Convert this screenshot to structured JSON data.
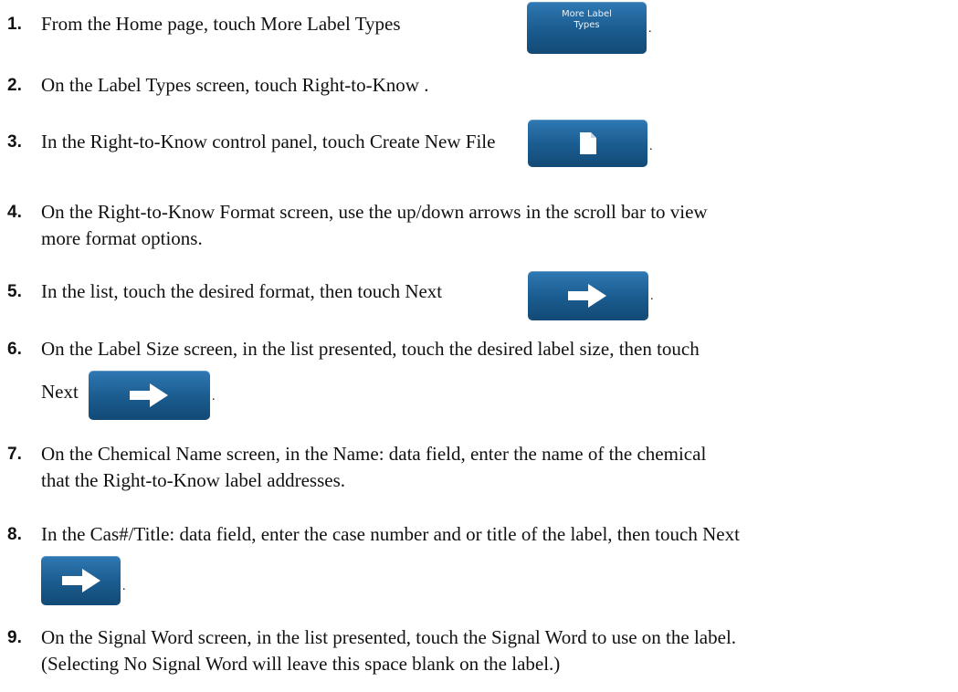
{
  "steps": [
    {
      "num": "1.",
      "text": "From the Home page, touch More Label Types",
      "after": "."
    },
    {
      "num": "2.",
      "text": "On the Label Types screen, touch Right-to-Know ."
    },
    {
      "num": "3.",
      "text": "In the Right-to-Know control panel, touch Create New File",
      "after": "."
    },
    {
      "num": "4.",
      "line1": "On the Right-to-Know Format screen, use the up/down arrows in the scroll bar to view",
      "line2": "more format options."
    },
    {
      "num": "5.",
      "text": "In the list, touch the desired format, then touch Next",
      "after": "."
    },
    {
      "num": "6.",
      "line1": "On the Label Size screen, in the list presented, touch the desired label size, then touch",
      "line2": "Next",
      "after": "."
    },
    {
      "num": "7.",
      "line1": "On the Chemical Name screen, in the Name: data field, enter the name of the chemical",
      "line2": "that the Right-to-Know label addresses."
    },
    {
      "num": "8.",
      "line1": "In the Cas#/Title: data field, enter the case number and or title of the label, then touch Next",
      "after": "."
    },
    {
      "num": "9.",
      "line1": "On the Signal Word screen, in the list presented, touch the Signal Word to use on the label.",
      "line2": "(Selecting No Signal Word will leave this space blank on the label.)"
    }
  ],
  "buttons": {
    "more_label_types": {
      "line1": "More Label",
      "line2": "Types"
    },
    "create_new_file": {
      "icon": "document-icon"
    },
    "next": {
      "icon": "arrow-right-icon"
    }
  },
  "colors": {
    "button_top": "#2f79b4",
    "button_bottom": "#134a76"
  }
}
